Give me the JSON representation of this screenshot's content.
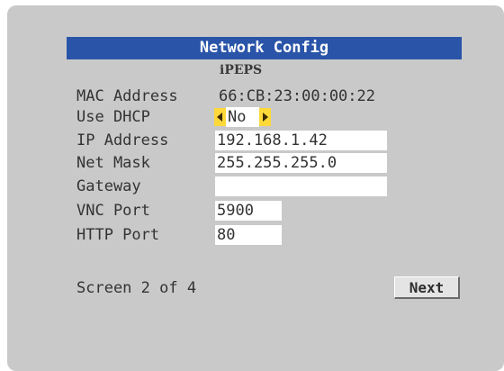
{
  "window": {
    "title": "Network Config",
    "device_name": "iPEPS"
  },
  "fields": {
    "mac": {
      "label": "MAC Address",
      "value": "66:CB:23:00:00:22"
    },
    "dhcp": {
      "label": "Use DHCP",
      "value": "No",
      "left_icon": "arrow-left-icon",
      "right_icon": "arrow-right-icon"
    },
    "ip": {
      "label": "IP Address",
      "value": "192.168.1.42"
    },
    "netmask": {
      "label": "Net Mask",
      "value": "255.255.255.0"
    },
    "gateway": {
      "label": "Gateway",
      "value": ""
    },
    "vnc_port": {
      "label": "VNC Port",
      "value": "5900"
    },
    "http_port": {
      "label": "HTTP Port",
      "value": "80"
    }
  },
  "footer": {
    "screen_indicator": "Screen 2 of 4",
    "next_label": "Next"
  },
  "colors": {
    "title_bar": "#2a54a8",
    "panel": "#c9c9c9",
    "arrow": "#ffd83a",
    "field": "#ffffff"
  }
}
